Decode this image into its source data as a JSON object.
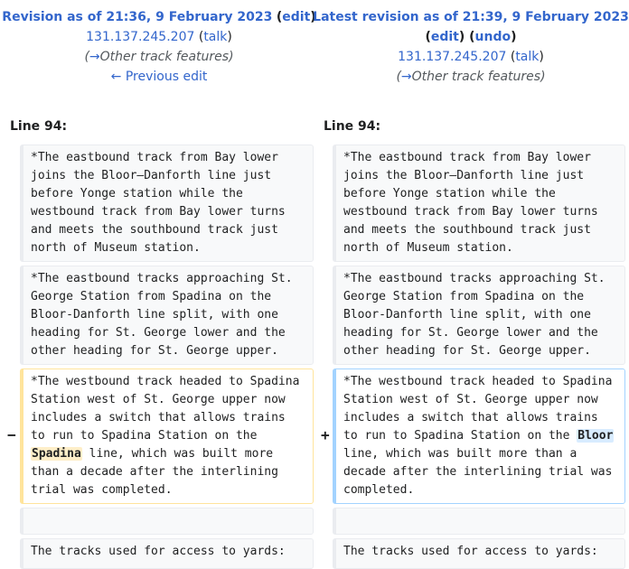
{
  "left_header": {
    "revision_title": "Revision as of 21:36, 9 February 2023",
    "edit": "edit",
    "user": "131.137.245.207",
    "talk": "talk",
    "summary_arrow": "→",
    "summary": "Other track features",
    "prev_edit": "← Previous edit"
  },
  "right_header": {
    "revision_title": "Latest revision as of 21:39, 9 February 2023",
    "edit": "edit",
    "undo": "undo",
    "user": "131.137.245.207",
    "talk": "talk",
    "summary_arrow": "→",
    "summary": "Other track features"
  },
  "line_label": "Line 94:",
  "markers": {
    "minus": "−",
    "plus": "+"
  },
  "context": {
    "p1": "*The eastbound track from Bay lower joins the Bloor–Danforth line just before Yonge station while the westbound track from Bay lower turns and meets the southbound track just north of Museum station.",
    "p2": "*The eastbound tracks approaching St. George Station from Spadina on the Bloor-Danforth line split, with one heading for St. George lower and the other heading for St. George upper.",
    "p4": "The tracks used for access to yards:"
  },
  "deleted": {
    "before": "*The westbound track headed to Spadina Station west of St. George upper now includes a switch that allows trains to run to Spadina Station on the ",
    "changed": "Spadina",
    "after": " line, which was built more than a decade after the interlining trial was completed."
  },
  "added": {
    "before": "*The westbound track headed to Spadina Station west of St. George upper now includes a switch that allows trains to run to Spadina Station on the ",
    "changed": "Bloor",
    "after": " line, which was built more than a decade after the interlining trial was completed."
  }
}
